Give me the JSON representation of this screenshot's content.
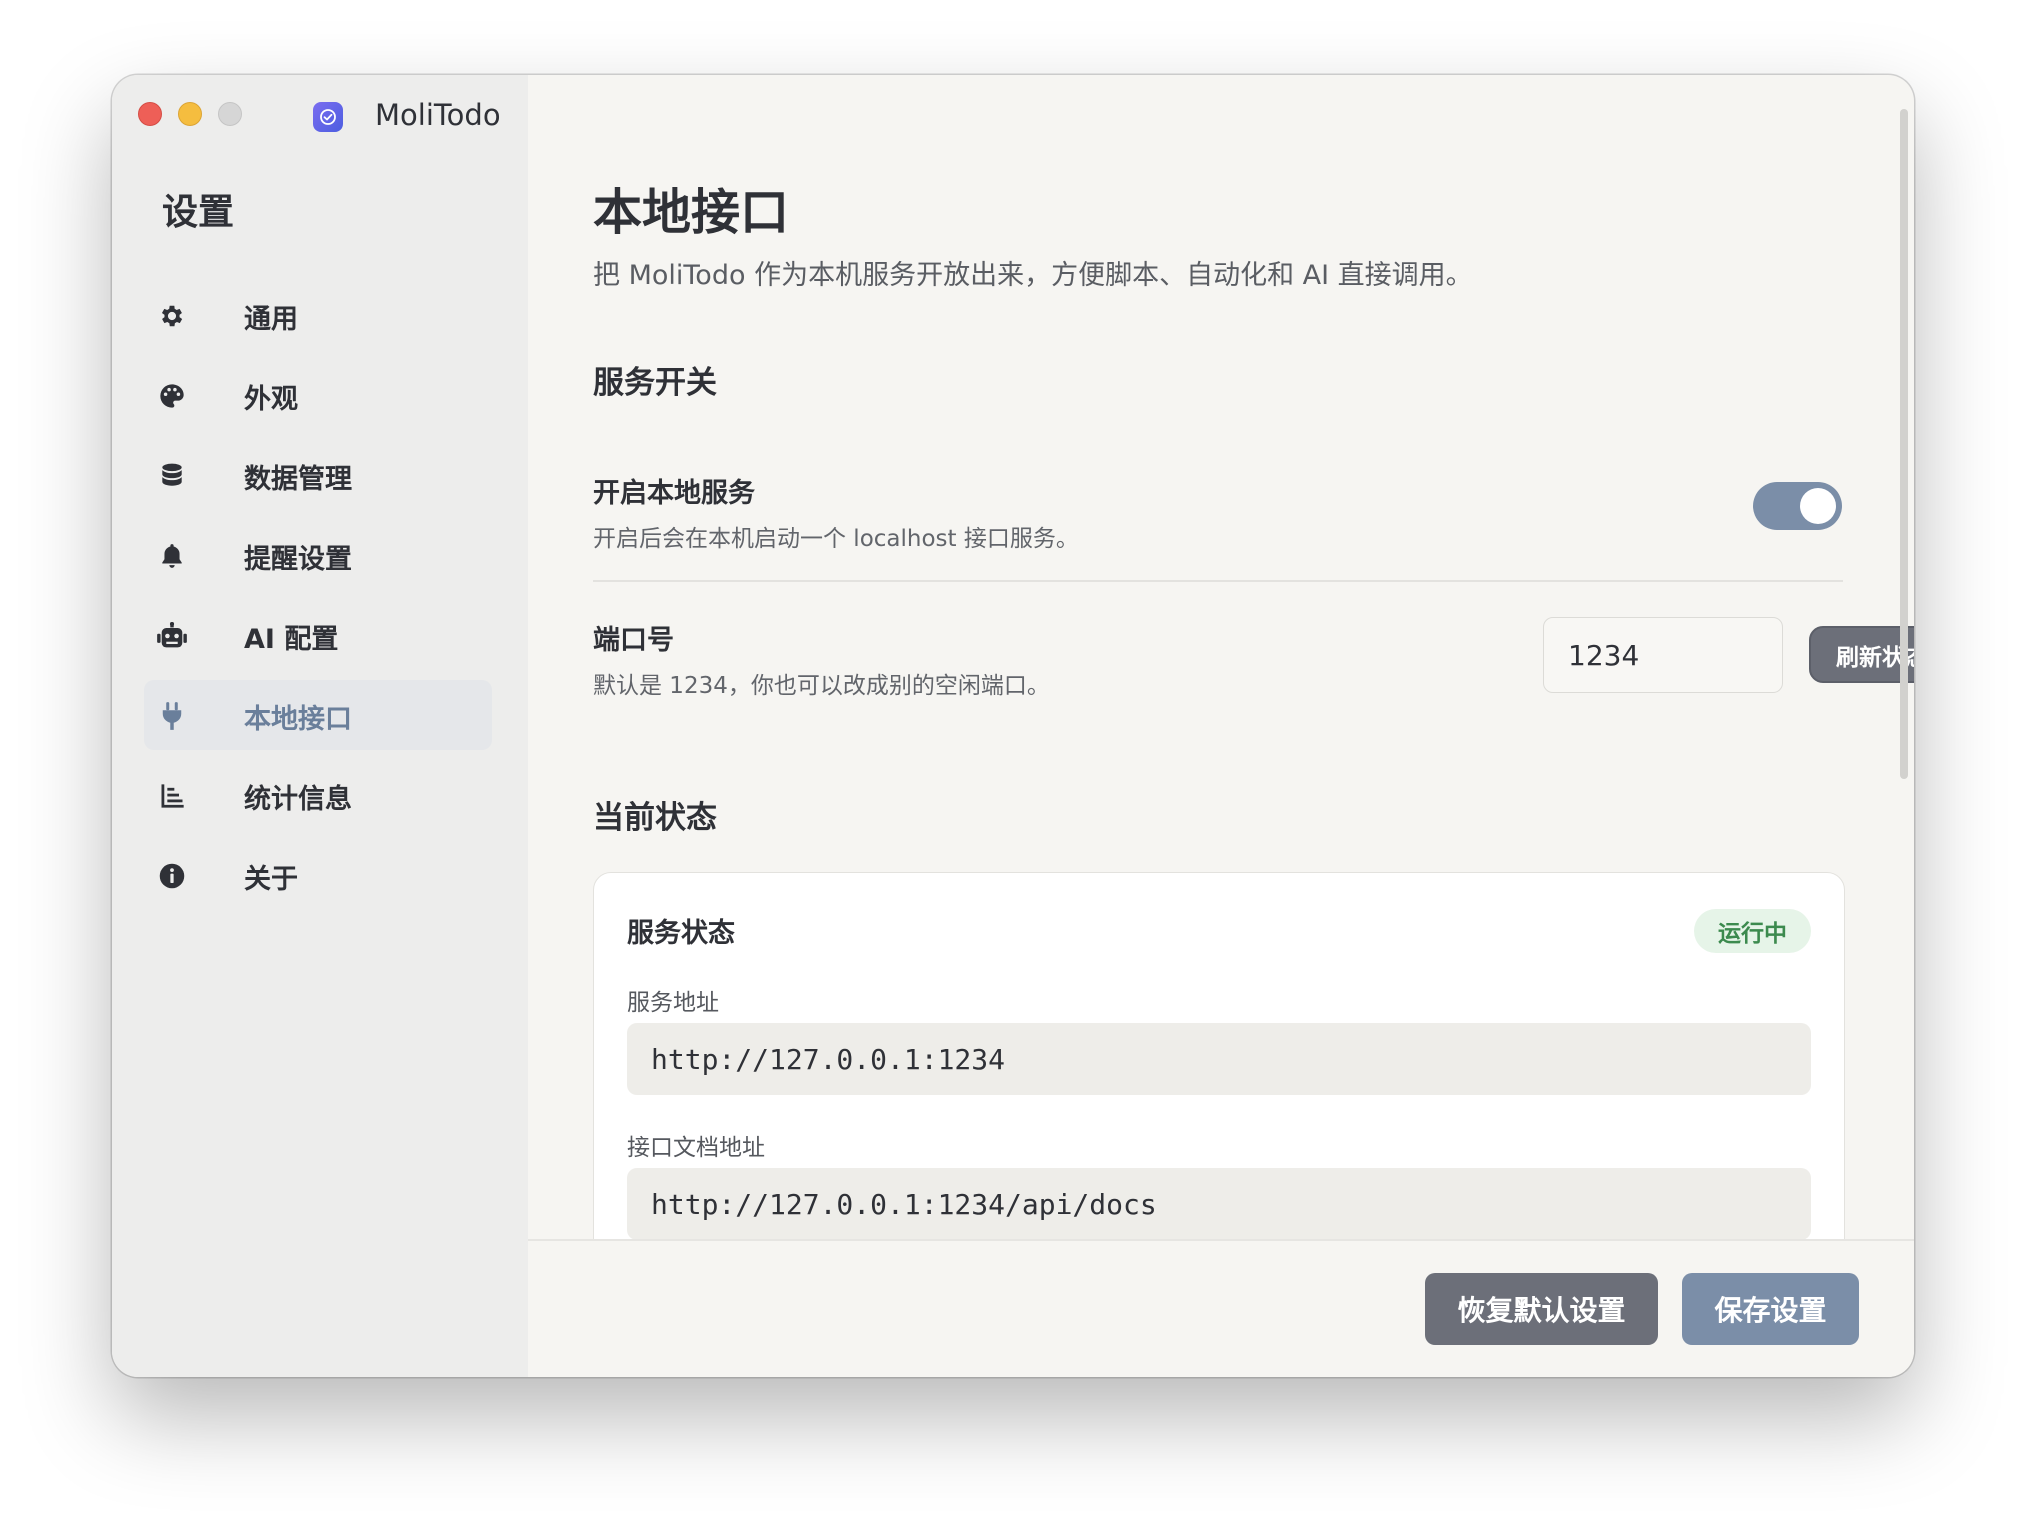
{
  "app": {
    "name": "MoliTodo"
  },
  "sidebar": {
    "title": "设置",
    "items": [
      {
        "label": "通用",
        "icon": "gear-icon"
      },
      {
        "label": "外观",
        "icon": "palette-icon"
      },
      {
        "label": "数据管理",
        "icon": "database-icon"
      },
      {
        "label": "提醒设置",
        "icon": "bell-icon"
      },
      {
        "label": "AI 配置",
        "icon": "robot-icon"
      },
      {
        "label": "本地接口",
        "icon": "plug-icon",
        "active": true
      },
      {
        "label": "统计信息",
        "icon": "bar-chart-icon"
      },
      {
        "label": "关于",
        "icon": "info-icon"
      }
    ]
  },
  "page": {
    "title": "本地接口",
    "subtitle": "把 MoliTodo 作为本机服务开放出来，方便脚本、自动化和 AI 直接调用。"
  },
  "service_switch": {
    "section_title": "服务开关",
    "enable": {
      "title": "开启本地服务",
      "description": "开启后会在本机启动一个 localhost 接口服务。",
      "enabled": true
    },
    "port": {
      "title": "端口号",
      "description": "默认是 1234，你也可以改成别的空闲端口。",
      "value": "1234",
      "refresh_label": "刷新状态"
    }
  },
  "current_status": {
    "section_title": "当前状态",
    "card_title": "服务状态",
    "badge": "运行中",
    "address_label": "服务地址",
    "address_value": "http://127.0.0.1:1234",
    "docs_label": "接口文档地址",
    "docs_value": "http://127.0.0.1:1234/api/docs"
  },
  "footer": {
    "reset_label": "恢复默认设置",
    "save_label": "保存设置"
  },
  "colors": {
    "accent": "#7b8ea8",
    "active_nav_text": "#6a7f9b",
    "badge_bg": "#e6f4e8",
    "badge_text": "#3c8a4e",
    "secondary_button": "#6c6f79"
  }
}
